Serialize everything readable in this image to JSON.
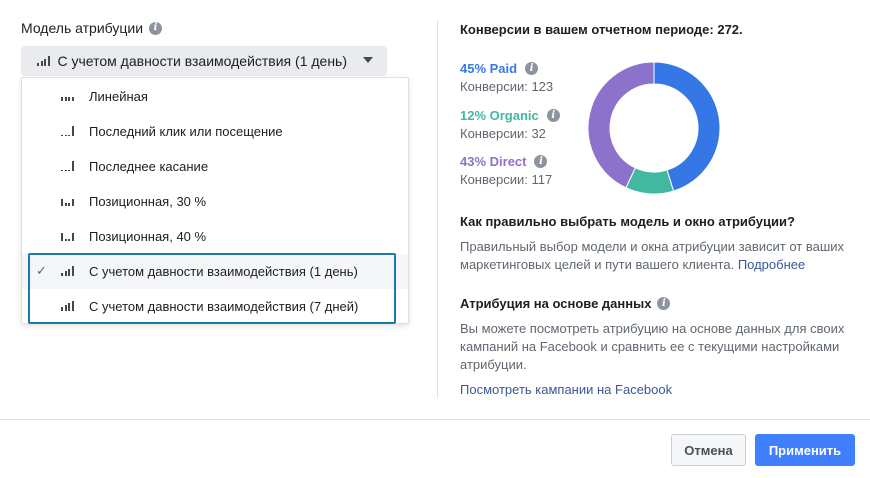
{
  "attribution": {
    "label": "Модель атрибуции",
    "selected": "С учетом давности взаимодействия (1 день)",
    "options": [
      {
        "label": "Линейная",
        "icon": "linear-bars-icon",
        "bars": [
          4,
          4,
          4,
          4
        ],
        "selected": false
      },
      {
        "label": "Последний клик или посещение",
        "icon": "last-click-bars-icon",
        "bars": [
          1,
          1,
          1,
          10
        ],
        "selected": false
      },
      {
        "label": "Последнее касание",
        "icon": "last-touch-bars-icon",
        "bars": [
          1,
          1,
          1,
          10
        ],
        "selected": false
      },
      {
        "label": "Позиционная, 30 %",
        "icon": "position-based-bars-icon",
        "bars": [
          7,
          3,
          3,
          7
        ],
        "selected": false
      },
      {
        "label": "Позиционная, 40 %",
        "icon": "position-based-bars-icon",
        "bars": [
          8,
          2,
          2,
          8
        ],
        "selected": false
      },
      {
        "label": "С учетом давности взаимодействия (1 день)",
        "icon": "time-decay-bars-icon",
        "bars": [
          3,
          5,
          7,
          10
        ],
        "selected": true
      },
      {
        "label": "С учетом давности взаимодействия (7 дней)",
        "icon": "time-decay-bars-icon",
        "bars": [
          4,
          6,
          8,
          10
        ],
        "selected": false
      }
    ]
  },
  "conversions": {
    "title": "Конверсии в вашем отчетном периоде: 272.",
    "items": [
      {
        "pct_label": "45% Paid",
        "sub": "Конверсии: 123",
        "color": "#3578e5"
      },
      {
        "pct_label": "12% Organic",
        "sub": "Конверсии: 32",
        "color": "#42b8a0"
      },
      {
        "pct_label": "43% Direct",
        "sub": "Конверсии: 117",
        "color": "#8c72cb"
      }
    ]
  },
  "chart_data": {
    "type": "pie",
    "style": "donut",
    "categories": [
      "Paid",
      "Organic",
      "Direct"
    ],
    "values": [
      123,
      32,
      117
    ],
    "percent": [
      45,
      12,
      43
    ],
    "colors": [
      "#3578e5",
      "#42b8a0",
      "#8c72cb"
    ]
  },
  "help": {
    "title": "Как правильно выбрать модель и окно атрибуции?",
    "text": "Правильный выбор модели и окна атрибуции зависит от ваших маркетинговых целей и пути вашего клиента.",
    "link": "Подробнее"
  },
  "data_driven": {
    "title": "Атрибуция на основе данных",
    "text": "Вы можете посмотреть атрибуцию на основе данных для своих кампаний на Facebook и сравнить ее с текущими настройками атрибуции.",
    "link": "Посмотреть кампании на Facebook"
  },
  "buttons": {
    "cancel": "Отмена",
    "apply": "Применить"
  }
}
